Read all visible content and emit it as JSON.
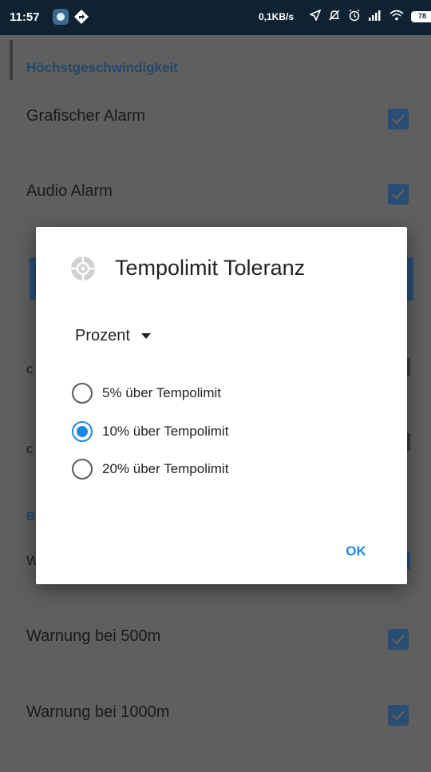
{
  "status_bar": {
    "time": "11:57",
    "network_speed": "0,1KB/s",
    "battery": "78",
    "icons": [
      "location-arrow-icon",
      "mute-icon",
      "alarm-icon",
      "signal-icon",
      "wifi-icon",
      "battery-icon"
    ]
  },
  "settings": {
    "section_speed": "Höchstgeschwindigkeit",
    "rows": [
      {
        "label": "Grafischer Alarm",
        "checked": true
      },
      {
        "label": "Audio Alarm",
        "checked": true
      },
      {
        "label": "Warnung bei 500m",
        "checked": true
      },
      {
        "label": "Warnung bei 1000m",
        "checked": true
      }
    ],
    "partial_letters": [
      "c",
      "c",
      "B",
      "W"
    ]
  },
  "dialog": {
    "title": "Tempolimit Toleranz",
    "spinner_value": "Prozent",
    "options": [
      {
        "label": "5% über Tempolimit",
        "selected": false
      },
      {
        "label": "10% über Tempolimit",
        "selected": true
      },
      {
        "label": "20% über Tempolimit",
        "selected": false
      }
    ],
    "ok_label": "OK"
  },
  "colors": {
    "accent": "#1e88e5",
    "status_bar": "#0f2232",
    "scrim_background": "#5f5f5f",
    "checkbox_dimmed": "#2a4d74"
  }
}
